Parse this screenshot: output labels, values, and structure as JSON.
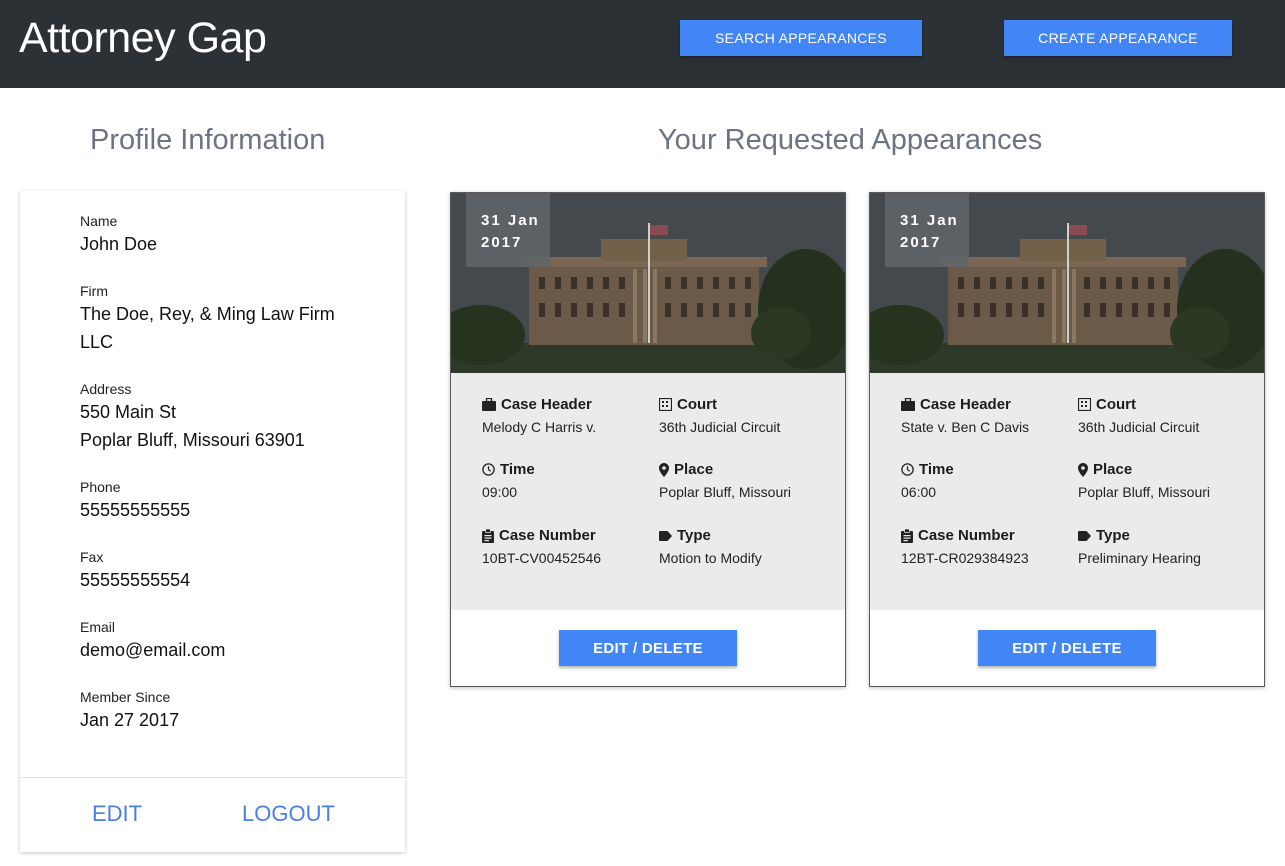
{
  "header": {
    "brand": "Attorney Gap",
    "search_label": "SEARCH APPEARANCES",
    "create_label": "CREATE APPEARANCE"
  },
  "profile": {
    "title": "Profile Information",
    "name_label": "Name",
    "name": "John Doe",
    "firm_label": "Firm",
    "firm_line1": "The Doe, Rey, & Ming Law Firm",
    "firm_line2": "LLC",
    "address_label": "Address",
    "address_line1": "550 Main St",
    "address_line2": "Poplar Bluff, Missouri 63901",
    "phone_label": "Phone",
    "phone": "55555555555",
    "fax_label": "Fax",
    "fax": "55555555554",
    "email_label": "Email",
    "email": "demo@email.com",
    "member_label": "Member Since",
    "member_since": "Jan 27 2017",
    "edit_label": "EDIT",
    "logout_label": "LOGOUT"
  },
  "appearances": {
    "title": "Your Requested Appearances",
    "labels": {
      "case_header": "Case Header",
      "court": "Court",
      "time": "Time",
      "place": "Place",
      "case_number": "Case Number",
      "type": "Type"
    },
    "cards": [
      {
        "date_day": "31 Jan",
        "date_year": "2017",
        "case_header": "Melody C Harris v.",
        "court": "36th Judicial Circuit",
        "time": "09:00",
        "place": "Poplar Bluff, Missouri",
        "case_number": "10BT-CV00452546",
        "type": "Motion to Modify",
        "edit_label": "EDIT / DELETE"
      },
      {
        "date_day": "31 Jan",
        "date_year": "2017",
        "case_header": "State v. Ben C Davis",
        "court": "36th Judicial Circuit",
        "time": "06:00",
        "place": "Poplar Bluff, Missouri",
        "case_number": "12BT-CR029384923",
        "type": "Preliminary Hearing",
        "edit_label": "EDIT / DELETE"
      }
    ]
  },
  "colors": {
    "header_bg": "#2b3134",
    "accent": "#4285f4",
    "link": "#4a7ee6",
    "details_bg": "#ebebeb"
  },
  "icons": {
    "case_header": "briefcase-icon",
    "court": "building-icon",
    "time": "clock-icon",
    "place": "map-pin-icon",
    "case_number": "clipboard-icon",
    "type": "tag-icon"
  }
}
